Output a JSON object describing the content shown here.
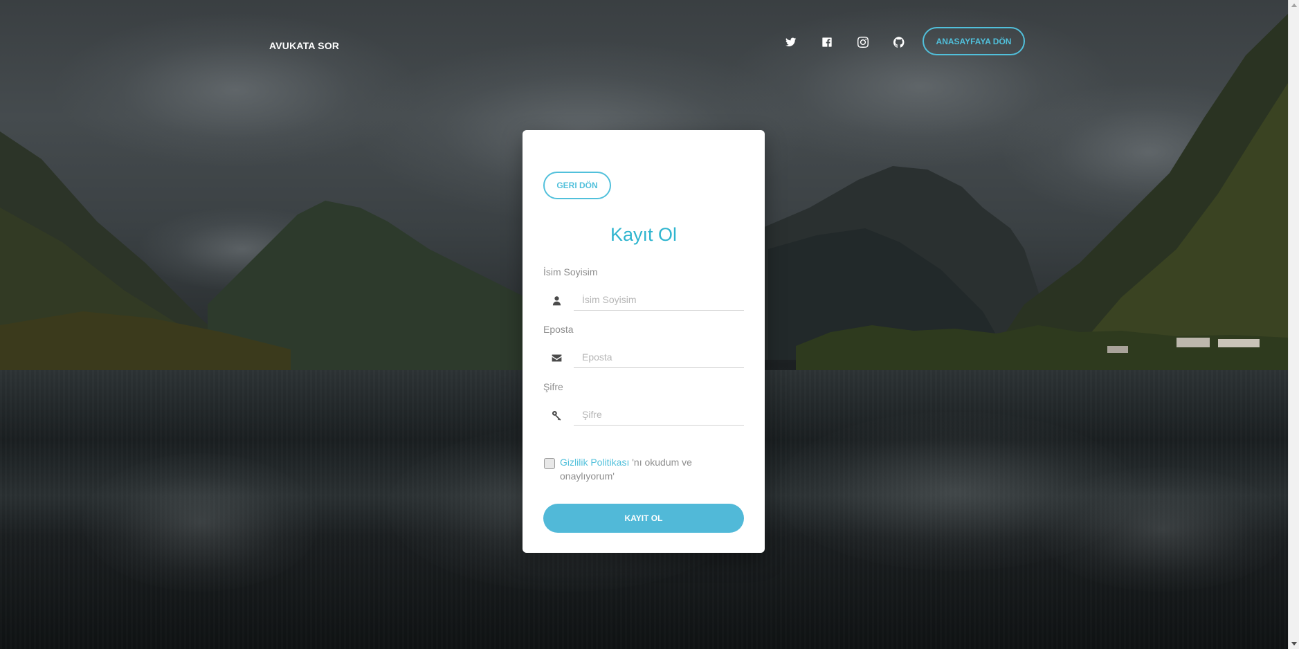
{
  "navbar": {
    "brand": "AVUKATA SOR",
    "social_icons": [
      "twitter-icon",
      "facebook-square-icon",
      "instagram-icon",
      "github-icon"
    ],
    "home_button": "ANASAYFAYA DÖN"
  },
  "card": {
    "back_button": "GERI DÖN",
    "title": "Kayıt Ol",
    "fields": [
      {
        "label": "İsim Soyisim",
        "placeholder": "İsim Soyisim",
        "icon": "user-icon"
      },
      {
        "label": "Eposta",
        "placeholder": "Eposta",
        "icon": "envelope-icon"
      },
      {
        "label": "Şifre",
        "placeholder": "Şifre",
        "icon": "key-icon"
      }
    ],
    "terms": {
      "link": "Gizlilik Politikası",
      "text": " 'nı okudum ve onaylıyorum'",
      "checked": false
    },
    "submit_button": "KAYIT OL"
  },
  "colors": {
    "accent": "#51c0db",
    "title": "#2fb5cf",
    "submit_bg": "#51b9d8"
  }
}
